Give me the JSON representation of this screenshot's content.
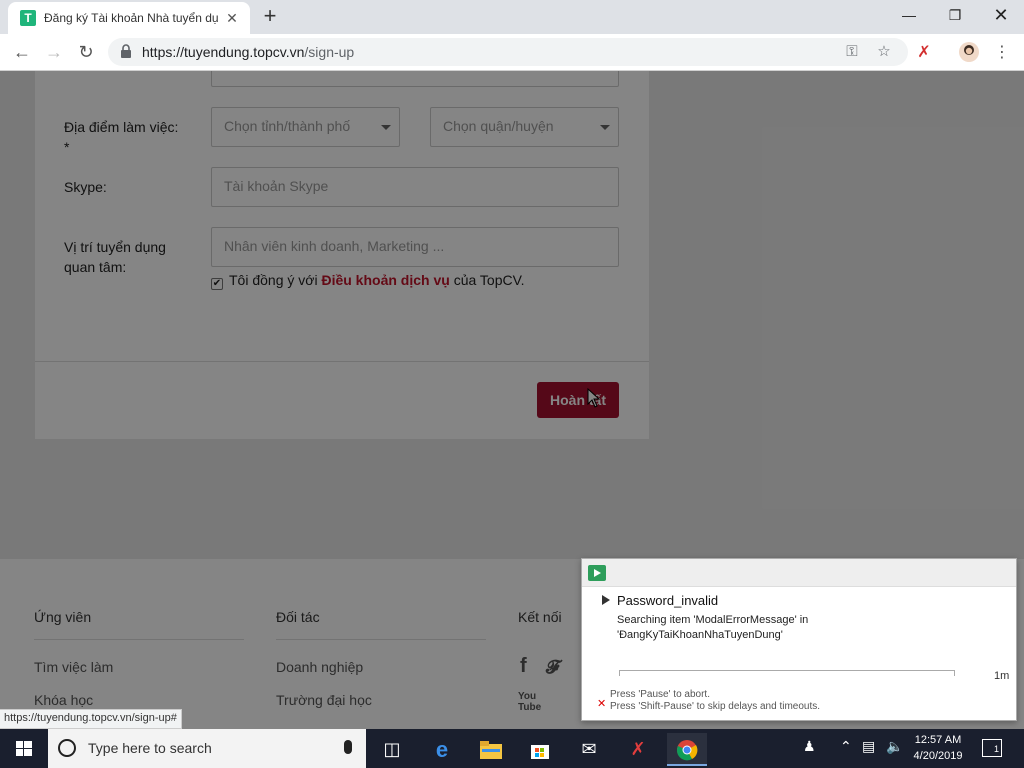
{
  "browser": {
    "tab_title": "Đăng ký Tài khoản Nhà tuyển dụ",
    "tab_favicon_letter": "T",
    "url_host": "https://tuyendung.topcv.vn",
    "url_path": "/sign-up",
    "status_url": "https://tuyendung.topcv.vn/sign-up#"
  },
  "form": {
    "location_label": "Địa điểm làm việc:",
    "location_required": "*",
    "province_placeholder": "Chọn tỉnh/thành phố",
    "district_placeholder": "Chọn quận/huyện",
    "skype_label": "Skype:",
    "skype_placeholder": "Tài khoản Skype",
    "position_label_1": "Vị trí tuyển dụng",
    "position_label_2": "quan tâm:",
    "position_placeholder": "Nhân viên kinh doanh, Marketing ...",
    "terms_prefix": "Tôi đồng ý với",
    "terms_link": "Điều khoản dịch vụ",
    "terms_suffix": "của TopCV.",
    "terms_checked": "✔",
    "submit_label": "Hoàn tất"
  },
  "footer": {
    "col1_title": "Ứng viên",
    "col1_links": [
      "Tìm việc làm",
      "Khóa học"
    ],
    "col2_title": "Đối tác",
    "col2_links": [
      "Doanh nghiệp",
      "Trường đại học"
    ],
    "col3_title": "Kết nối",
    "social": [
      "f",
      "twitter-icon",
      "You Tube"
    ]
  },
  "runner": {
    "test_name": "Password_invalid",
    "message_1": "Searching item 'ModalErrorMessage' in",
    "message_2": "'ĐangKyTaiKhoanNhaTuyenDung'",
    "time": "1m",
    "hint_1": "Press 'Pause' to abort.",
    "hint_2": "Press 'Shift-Pause' to skip delays and timeouts.",
    "hint_icon": "✕"
  },
  "taskbar": {
    "search_placeholder": "Type here to search",
    "time": "12:57 AM",
    "date": "4/20/2019",
    "notification_count": "1"
  }
}
